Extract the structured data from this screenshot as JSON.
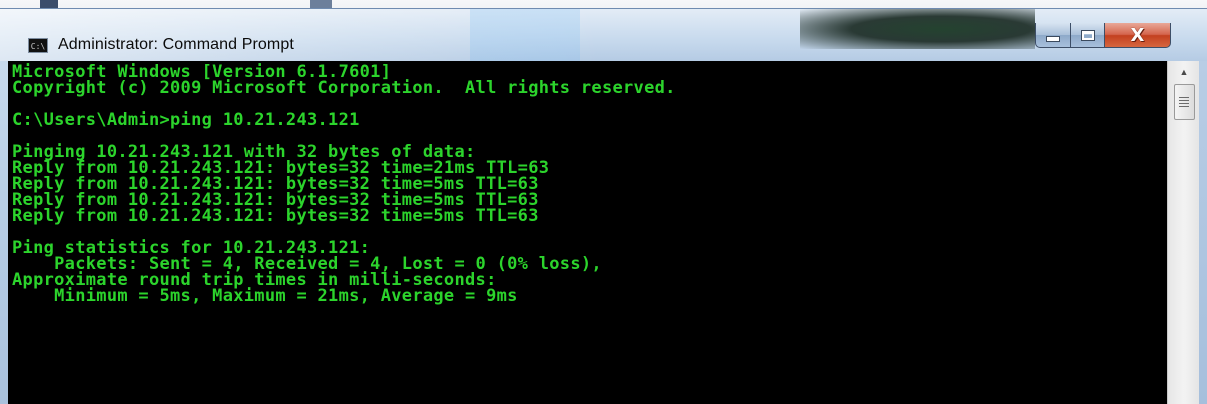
{
  "window": {
    "title": "Administrator: Command Prompt",
    "icon_label": "C:\\"
  },
  "controls": {
    "minimize_icon": "minimize-icon",
    "maximize_icon": "maximize-icon",
    "close_icon": "close-icon",
    "close_glyph": "X"
  },
  "console": {
    "lines": [
      "Microsoft Windows [Version 6.1.7601]",
      "Copyright (c) 2009 Microsoft Corporation.  All rights reserved.",
      "",
      "C:\\Users\\Admin>ping 10.21.243.121",
      "",
      "Pinging 10.21.243.121 with 32 bytes of data:",
      "Reply from 10.21.243.121: bytes=32 time=21ms TTL=63",
      "Reply from 10.21.243.121: bytes=32 time=5ms TTL=63",
      "Reply from 10.21.243.121: bytes=32 time=5ms TTL=63",
      "Reply from 10.21.243.121: bytes=32 time=5ms TTL=63",
      "",
      "Ping statistics for 10.21.243.121:",
      "    Packets: Sent = 4, Received = 4, Lost = 0 (0% loss),",
      "Approximate round trip times in milli-seconds:",
      "    Minimum = 5ms, Maximum = 21ms, Average = 9ms"
    ],
    "text_color": "#2cd42c",
    "background_color": "#000000"
  },
  "scrollbar": {
    "up_arrow_icon": "scroll-up-arrow-icon",
    "up_arrow_glyph": "▲"
  }
}
